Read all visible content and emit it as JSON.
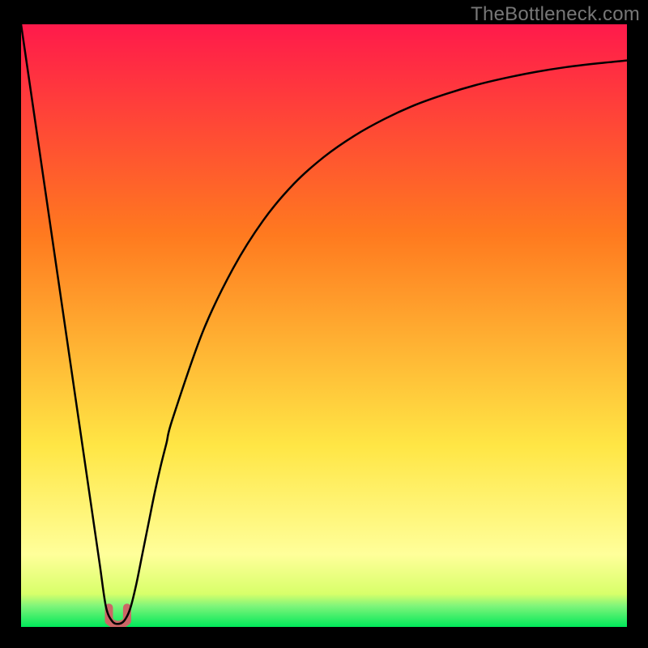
{
  "watermark": "TheBottleneck.com",
  "colors": {
    "gradient_top": "#ff1a4b",
    "gradient_mid_orange": "#ff7a1f",
    "gradient_yellow": "#ffe645",
    "gradient_pale_yellow": "#ffff9a",
    "gradient_bottom": "#00e85a",
    "curve": "#000000",
    "curve_base": "#cc6666",
    "frame": "#000000"
  },
  "chart_data": {
    "type": "line",
    "title": "",
    "xlabel": "",
    "ylabel": "",
    "xlim": [
      0,
      100
    ],
    "ylim": [
      0,
      100
    ],
    "grid": false,
    "x": [
      0,
      1,
      2,
      3,
      4,
      5,
      6,
      7,
      8,
      9,
      10,
      11,
      12,
      13,
      14,
      15,
      16,
      17,
      18,
      19,
      20,
      21,
      22,
      23,
      24,
      25,
      30,
      35,
      40,
      45,
      50,
      55,
      60,
      65,
      70,
      75,
      80,
      85,
      90,
      95,
      100
    ],
    "series": [
      {
        "name": "bottleneck-curve",
        "values": [
          100,
          93.1,
          86.2,
          79.3,
          72.4,
          65.5,
          58.6,
          51.7,
          44.8,
          37.9,
          31.0,
          24.1,
          17.2,
          10.3,
          3.4,
          1.0,
          0.5,
          1.0,
          3.0,
          7.0,
          12.0,
          17.0,
          22.0,
          26.5,
          30.5,
          34.5,
          49.0,
          59.5,
          67.5,
          73.5,
          78.0,
          81.5,
          84.3,
          86.6,
          88.4,
          89.9,
          91.1,
          92.1,
          92.9,
          93.5,
          94.0
        ]
      }
    ],
    "annotations": [
      {
        "name": "curve-minimum-marker",
        "x_range": [
          14.5,
          17.5
        ],
        "y_range": [
          0.2,
          3.2
        ],
        "color": "#cc6666",
        "shape": "U"
      }
    ],
    "background_gradient_stops": [
      {
        "offset": 0.0,
        "color": "#ff1a4b"
      },
      {
        "offset": 0.35,
        "color": "#ff7a1f"
      },
      {
        "offset": 0.7,
        "color": "#ffe645"
      },
      {
        "offset": 0.88,
        "color": "#ffff9a"
      },
      {
        "offset": 0.945,
        "color": "#d8ff6a"
      },
      {
        "offset": 0.965,
        "color": "#80f57a"
      },
      {
        "offset": 1.0,
        "color": "#00e85a"
      }
    ]
  }
}
